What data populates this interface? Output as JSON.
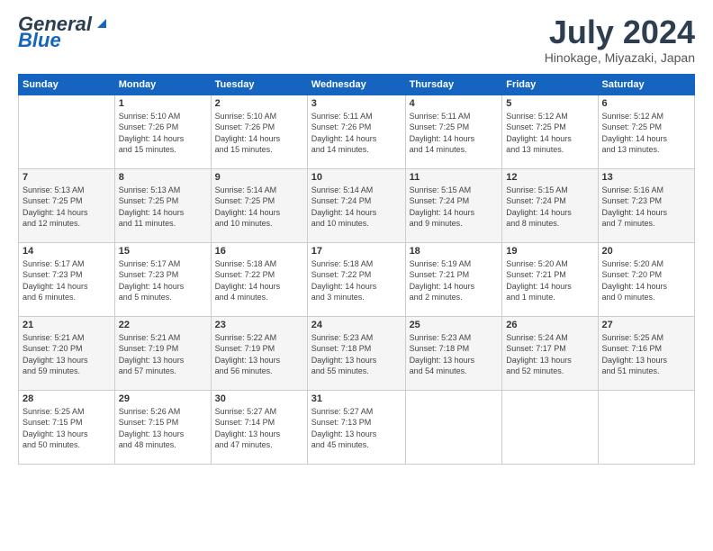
{
  "logo": {
    "line1": "General",
    "line2": "Blue"
  },
  "title": "July 2024",
  "subtitle": "Hinokage, Miyazaki, Japan",
  "weekdays": [
    "Sunday",
    "Monday",
    "Tuesday",
    "Wednesday",
    "Thursday",
    "Friday",
    "Saturday"
  ],
  "weeks": [
    [
      {
        "day": "",
        "info": ""
      },
      {
        "day": "1",
        "info": "Sunrise: 5:10 AM\nSunset: 7:26 PM\nDaylight: 14 hours\nand 15 minutes."
      },
      {
        "day": "2",
        "info": "Sunrise: 5:10 AM\nSunset: 7:26 PM\nDaylight: 14 hours\nand 15 minutes."
      },
      {
        "day": "3",
        "info": "Sunrise: 5:11 AM\nSunset: 7:26 PM\nDaylight: 14 hours\nand 14 minutes."
      },
      {
        "day": "4",
        "info": "Sunrise: 5:11 AM\nSunset: 7:25 PM\nDaylight: 14 hours\nand 14 minutes."
      },
      {
        "day": "5",
        "info": "Sunrise: 5:12 AM\nSunset: 7:25 PM\nDaylight: 14 hours\nand 13 minutes."
      },
      {
        "day": "6",
        "info": "Sunrise: 5:12 AM\nSunset: 7:25 PM\nDaylight: 14 hours\nand 13 minutes."
      }
    ],
    [
      {
        "day": "7",
        "info": "Sunrise: 5:13 AM\nSunset: 7:25 PM\nDaylight: 14 hours\nand 12 minutes."
      },
      {
        "day": "8",
        "info": "Sunrise: 5:13 AM\nSunset: 7:25 PM\nDaylight: 14 hours\nand 11 minutes."
      },
      {
        "day": "9",
        "info": "Sunrise: 5:14 AM\nSunset: 7:25 PM\nDaylight: 14 hours\nand 10 minutes."
      },
      {
        "day": "10",
        "info": "Sunrise: 5:14 AM\nSunset: 7:24 PM\nDaylight: 14 hours\nand 10 minutes."
      },
      {
        "day": "11",
        "info": "Sunrise: 5:15 AM\nSunset: 7:24 PM\nDaylight: 14 hours\nand 9 minutes."
      },
      {
        "day": "12",
        "info": "Sunrise: 5:15 AM\nSunset: 7:24 PM\nDaylight: 14 hours\nand 8 minutes."
      },
      {
        "day": "13",
        "info": "Sunrise: 5:16 AM\nSunset: 7:23 PM\nDaylight: 14 hours\nand 7 minutes."
      }
    ],
    [
      {
        "day": "14",
        "info": "Sunrise: 5:17 AM\nSunset: 7:23 PM\nDaylight: 14 hours\nand 6 minutes."
      },
      {
        "day": "15",
        "info": "Sunrise: 5:17 AM\nSunset: 7:23 PM\nDaylight: 14 hours\nand 5 minutes."
      },
      {
        "day": "16",
        "info": "Sunrise: 5:18 AM\nSunset: 7:22 PM\nDaylight: 14 hours\nand 4 minutes."
      },
      {
        "day": "17",
        "info": "Sunrise: 5:18 AM\nSunset: 7:22 PM\nDaylight: 14 hours\nand 3 minutes."
      },
      {
        "day": "18",
        "info": "Sunrise: 5:19 AM\nSunset: 7:21 PM\nDaylight: 14 hours\nand 2 minutes."
      },
      {
        "day": "19",
        "info": "Sunrise: 5:20 AM\nSunset: 7:21 PM\nDaylight: 14 hours\nand 1 minute."
      },
      {
        "day": "20",
        "info": "Sunrise: 5:20 AM\nSunset: 7:20 PM\nDaylight: 14 hours\nand 0 minutes."
      }
    ],
    [
      {
        "day": "21",
        "info": "Sunrise: 5:21 AM\nSunset: 7:20 PM\nDaylight: 13 hours\nand 59 minutes."
      },
      {
        "day": "22",
        "info": "Sunrise: 5:21 AM\nSunset: 7:19 PM\nDaylight: 13 hours\nand 57 minutes."
      },
      {
        "day": "23",
        "info": "Sunrise: 5:22 AM\nSunset: 7:19 PM\nDaylight: 13 hours\nand 56 minutes."
      },
      {
        "day": "24",
        "info": "Sunrise: 5:23 AM\nSunset: 7:18 PM\nDaylight: 13 hours\nand 55 minutes."
      },
      {
        "day": "25",
        "info": "Sunrise: 5:23 AM\nSunset: 7:18 PM\nDaylight: 13 hours\nand 54 minutes."
      },
      {
        "day": "26",
        "info": "Sunrise: 5:24 AM\nSunset: 7:17 PM\nDaylight: 13 hours\nand 52 minutes."
      },
      {
        "day": "27",
        "info": "Sunrise: 5:25 AM\nSunset: 7:16 PM\nDaylight: 13 hours\nand 51 minutes."
      }
    ],
    [
      {
        "day": "28",
        "info": "Sunrise: 5:25 AM\nSunset: 7:15 PM\nDaylight: 13 hours\nand 50 minutes."
      },
      {
        "day": "29",
        "info": "Sunrise: 5:26 AM\nSunset: 7:15 PM\nDaylight: 13 hours\nand 48 minutes."
      },
      {
        "day": "30",
        "info": "Sunrise: 5:27 AM\nSunset: 7:14 PM\nDaylight: 13 hours\nand 47 minutes."
      },
      {
        "day": "31",
        "info": "Sunrise: 5:27 AM\nSunset: 7:13 PM\nDaylight: 13 hours\nand 45 minutes."
      },
      {
        "day": "",
        "info": ""
      },
      {
        "day": "",
        "info": ""
      },
      {
        "day": "",
        "info": ""
      }
    ]
  ]
}
